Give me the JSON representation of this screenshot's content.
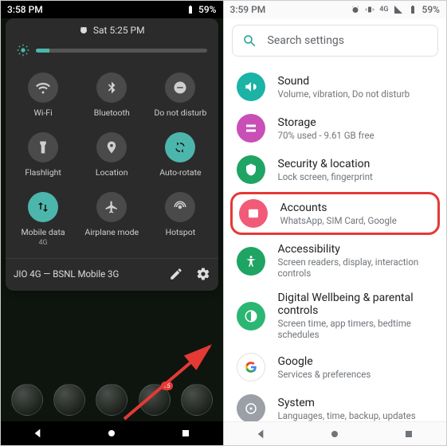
{
  "left": {
    "status": {
      "time": "3:58 PM",
      "battery_pct": "59%"
    },
    "qs": {
      "alarm_label": "Sat 5:25 PM",
      "tiles": [
        {
          "name": "wifi",
          "label": "Wi-Fi",
          "active": false
        },
        {
          "name": "bluetooth",
          "label": "Bluetooth",
          "active": false
        },
        {
          "name": "dnd",
          "label": "Do not disturb",
          "active": false
        },
        {
          "name": "flashlight",
          "label": "Flashlight",
          "active": false
        },
        {
          "name": "location",
          "label": "Location",
          "active": false
        },
        {
          "name": "autorotate",
          "label": "Auto-rotate",
          "active": true
        },
        {
          "name": "mobiledata",
          "label": "Mobile data",
          "sub": "4G",
          "active": true
        },
        {
          "name": "airplane",
          "label": "Airplane mode",
          "active": false
        },
        {
          "name": "hotspot",
          "label": "Hotspot",
          "active": false
        }
      ],
      "carrier": "JIO 4G — BSNL Mobile 3G"
    },
    "dock_badge": "15"
  },
  "right": {
    "status": {
      "time": "3:59 PM",
      "net_label": "4G",
      "battery_pct": "59%"
    },
    "search_placeholder": "Search settings",
    "items": [
      {
        "icon": "sound",
        "color": "#1ab3a6",
        "title": "Sound",
        "sub": "Volume, vibration, Do not disturb"
      },
      {
        "icon": "storage",
        "color": "#c94fb7",
        "title": "Storage",
        "sub": "70% used - 9.61 GB free"
      },
      {
        "icon": "security",
        "color": "#1fa463",
        "title": "Security & location",
        "sub": "Lock screen, fingerprint"
      },
      {
        "icon": "accounts",
        "color": "#f15b78",
        "title": "Accounts",
        "sub": "WhatsApp, SIM Card, Google",
        "highlight": true
      },
      {
        "icon": "a11y",
        "color": "#1fa463",
        "title": "Accessibility",
        "sub": "Screen readers, display, interaction controls"
      },
      {
        "icon": "wellbeing",
        "color": "#2bb673",
        "title": "Digital Wellbeing & parental controls",
        "sub": "Screen time, app timers, bedtime schedules"
      },
      {
        "icon": "google",
        "color": "#ffffff",
        "title": "Google",
        "sub": "Services & preferences"
      },
      {
        "icon": "system",
        "color": "#9aa0a6",
        "title": "System",
        "sub": "Languages, time, backup, updates"
      }
    ]
  }
}
